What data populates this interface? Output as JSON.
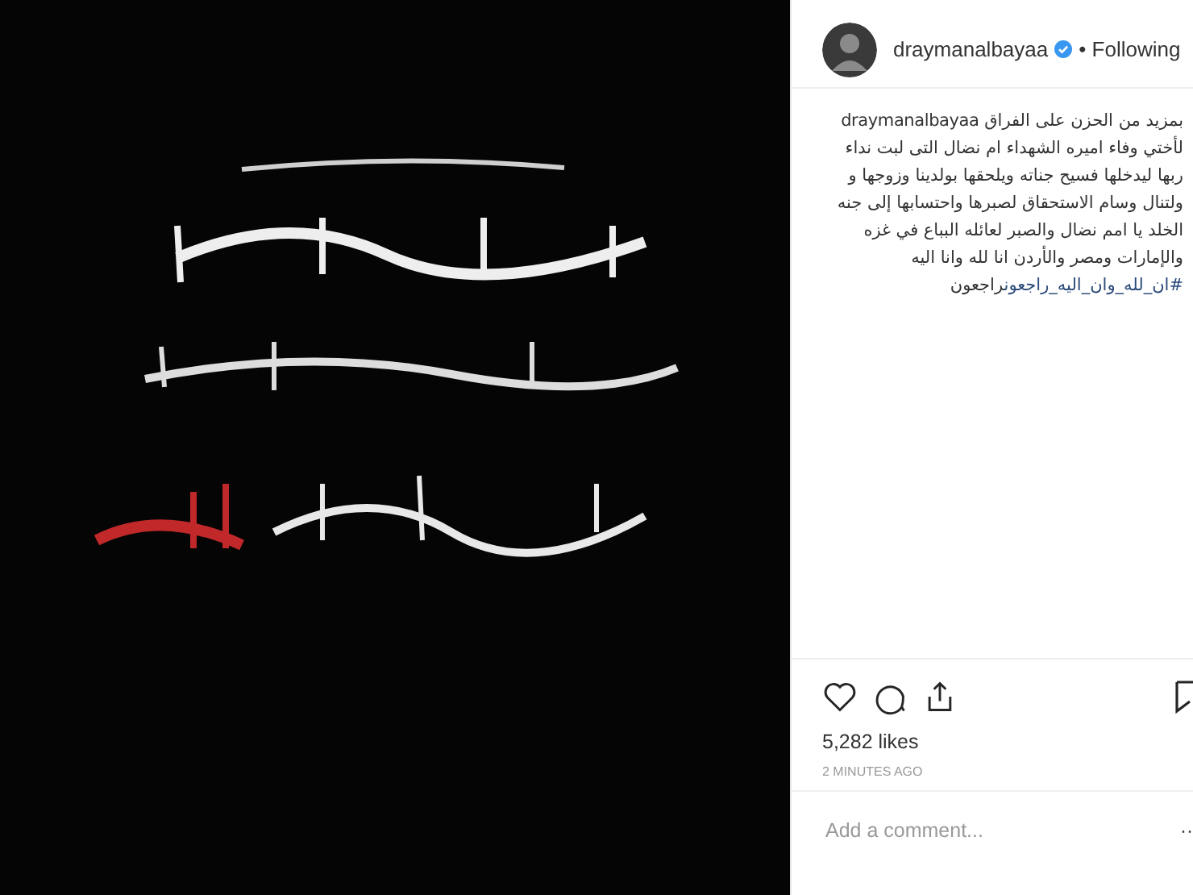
{
  "header": {
    "username": "draymanalbayaa",
    "verified": true,
    "follow_status": "• Following"
  },
  "caption": {
    "username": "draymanalbayaa",
    "lines": [
      "بمزيد من الحزن على الفراق",
      "لأختي وفاء اميره الشهداء ام نضال التى لبت نداء",
      "ربها ليدخلها فسيح جناته ويلحقها بولدينا وزوجها و",
      "ولتنال وسام الاستحقاق لصبرها واحتسابها إلى جنه",
      "الخلد يا امم نضال والصبر لعائله البباع في غزه",
      "والإمارات ومصر والأردن انا لله وانا اليه"
    ],
    "last_line": "راجعون",
    "hashtag": "#ان_لله_وان_اليه_راجعون"
  },
  "likes": "5,282 likes",
  "time": "2 MINUTES AGO",
  "comment": {
    "placeholder": "Add a comment...",
    "more": "··"
  }
}
